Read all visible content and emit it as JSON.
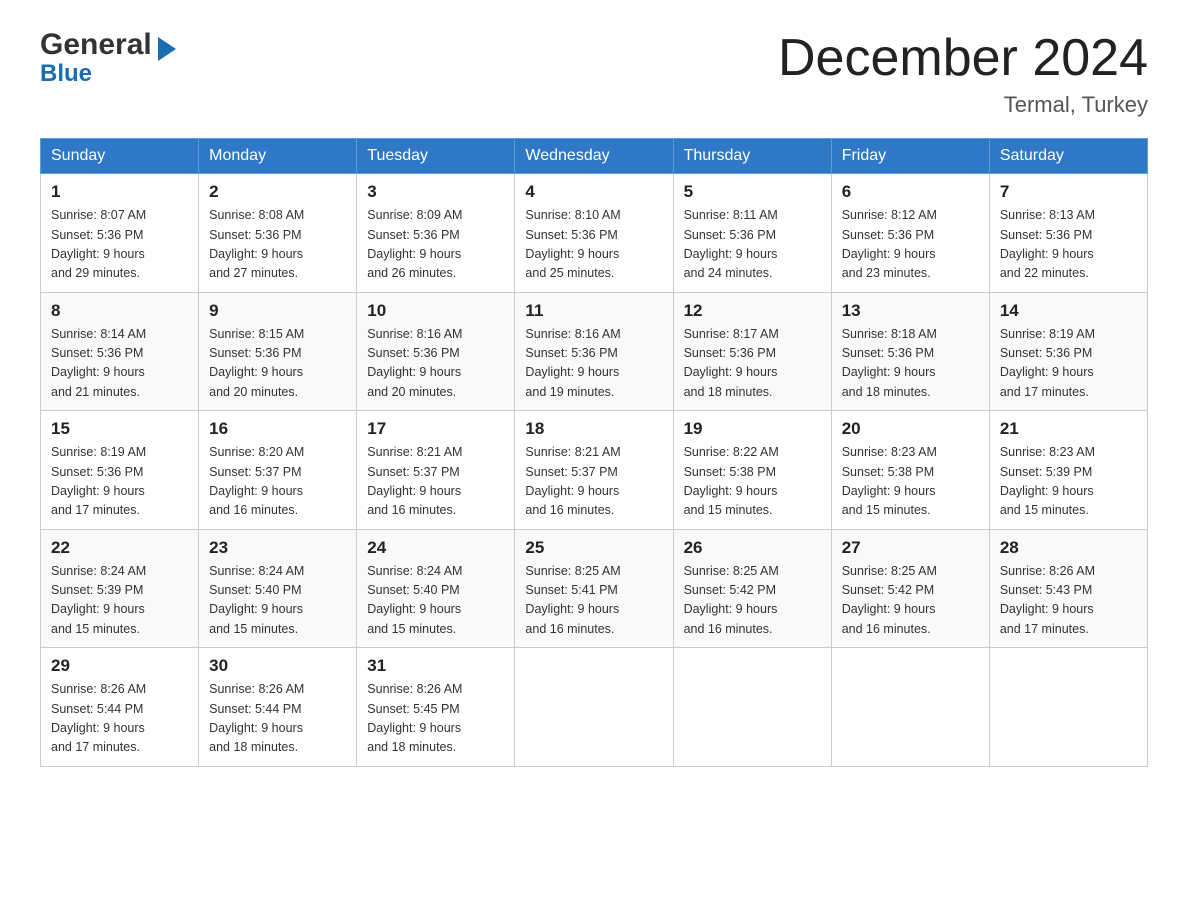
{
  "header": {
    "logo_general": "General",
    "logo_blue": "Blue",
    "month_title": "December 2024",
    "location": "Termal, Turkey"
  },
  "weekdays": [
    "Sunday",
    "Monday",
    "Tuesday",
    "Wednesday",
    "Thursday",
    "Friday",
    "Saturday"
  ],
  "weeks": [
    [
      {
        "day": "1",
        "sunrise": "8:07 AM",
        "sunset": "5:36 PM",
        "daylight": "9 hours and 29 minutes."
      },
      {
        "day": "2",
        "sunrise": "8:08 AM",
        "sunset": "5:36 PM",
        "daylight": "9 hours and 27 minutes."
      },
      {
        "day": "3",
        "sunrise": "8:09 AM",
        "sunset": "5:36 PM",
        "daylight": "9 hours and 26 minutes."
      },
      {
        "day": "4",
        "sunrise": "8:10 AM",
        "sunset": "5:36 PM",
        "daylight": "9 hours and 25 minutes."
      },
      {
        "day": "5",
        "sunrise": "8:11 AM",
        "sunset": "5:36 PM",
        "daylight": "9 hours and 24 minutes."
      },
      {
        "day": "6",
        "sunrise": "8:12 AM",
        "sunset": "5:36 PM",
        "daylight": "9 hours and 23 minutes."
      },
      {
        "day": "7",
        "sunrise": "8:13 AM",
        "sunset": "5:36 PM",
        "daylight": "9 hours and 22 minutes."
      }
    ],
    [
      {
        "day": "8",
        "sunrise": "8:14 AM",
        "sunset": "5:36 PM",
        "daylight": "9 hours and 21 minutes."
      },
      {
        "day": "9",
        "sunrise": "8:15 AM",
        "sunset": "5:36 PM",
        "daylight": "9 hours and 20 minutes."
      },
      {
        "day": "10",
        "sunrise": "8:16 AM",
        "sunset": "5:36 PM",
        "daylight": "9 hours and 20 minutes."
      },
      {
        "day": "11",
        "sunrise": "8:16 AM",
        "sunset": "5:36 PM",
        "daylight": "9 hours and 19 minutes."
      },
      {
        "day": "12",
        "sunrise": "8:17 AM",
        "sunset": "5:36 PM",
        "daylight": "9 hours and 18 minutes."
      },
      {
        "day": "13",
        "sunrise": "8:18 AM",
        "sunset": "5:36 PM",
        "daylight": "9 hours and 18 minutes."
      },
      {
        "day": "14",
        "sunrise": "8:19 AM",
        "sunset": "5:36 PM",
        "daylight": "9 hours and 17 minutes."
      }
    ],
    [
      {
        "day": "15",
        "sunrise": "8:19 AM",
        "sunset": "5:36 PM",
        "daylight": "9 hours and 17 minutes."
      },
      {
        "day": "16",
        "sunrise": "8:20 AM",
        "sunset": "5:37 PM",
        "daylight": "9 hours and 16 minutes."
      },
      {
        "day": "17",
        "sunrise": "8:21 AM",
        "sunset": "5:37 PM",
        "daylight": "9 hours and 16 minutes."
      },
      {
        "day": "18",
        "sunrise": "8:21 AM",
        "sunset": "5:37 PM",
        "daylight": "9 hours and 16 minutes."
      },
      {
        "day": "19",
        "sunrise": "8:22 AM",
        "sunset": "5:38 PM",
        "daylight": "9 hours and 15 minutes."
      },
      {
        "day": "20",
        "sunrise": "8:23 AM",
        "sunset": "5:38 PM",
        "daylight": "9 hours and 15 minutes."
      },
      {
        "day": "21",
        "sunrise": "8:23 AM",
        "sunset": "5:39 PM",
        "daylight": "9 hours and 15 minutes."
      }
    ],
    [
      {
        "day": "22",
        "sunrise": "8:24 AM",
        "sunset": "5:39 PM",
        "daylight": "9 hours and 15 minutes."
      },
      {
        "day": "23",
        "sunrise": "8:24 AM",
        "sunset": "5:40 PM",
        "daylight": "9 hours and 15 minutes."
      },
      {
        "day": "24",
        "sunrise": "8:24 AM",
        "sunset": "5:40 PM",
        "daylight": "9 hours and 15 minutes."
      },
      {
        "day": "25",
        "sunrise": "8:25 AM",
        "sunset": "5:41 PM",
        "daylight": "9 hours and 16 minutes."
      },
      {
        "day": "26",
        "sunrise": "8:25 AM",
        "sunset": "5:42 PM",
        "daylight": "9 hours and 16 minutes."
      },
      {
        "day": "27",
        "sunrise": "8:25 AM",
        "sunset": "5:42 PM",
        "daylight": "9 hours and 16 minutes."
      },
      {
        "day": "28",
        "sunrise": "8:26 AM",
        "sunset": "5:43 PM",
        "daylight": "9 hours and 17 minutes."
      }
    ],
    [
      {
        "day": "29",
        "sunrise": "8:26 AM",
        "sunset": "5:44 PM",
        "daylight": "9 hours and 17 minutes."
      },
      {
        "day": "30",
        "sunrise": "8:26 AM",
        "sunset": "5:44 PM",
        "daylight": "9 hours and 18 minutes."
      },
      {
        "day": "31",
        "sunrise": "8:26 AM",
        "sunset": "5:45 PM",
        "daylight": "9 hours and 18 minutes."
      },
      null,
      null,
      null,
      null
    ]
  ],
  "labels": {
    "sunrise": "Sunrise:",
    "sunset": "Sunset:",
    "daylight": "Daylight:"
  }
}
